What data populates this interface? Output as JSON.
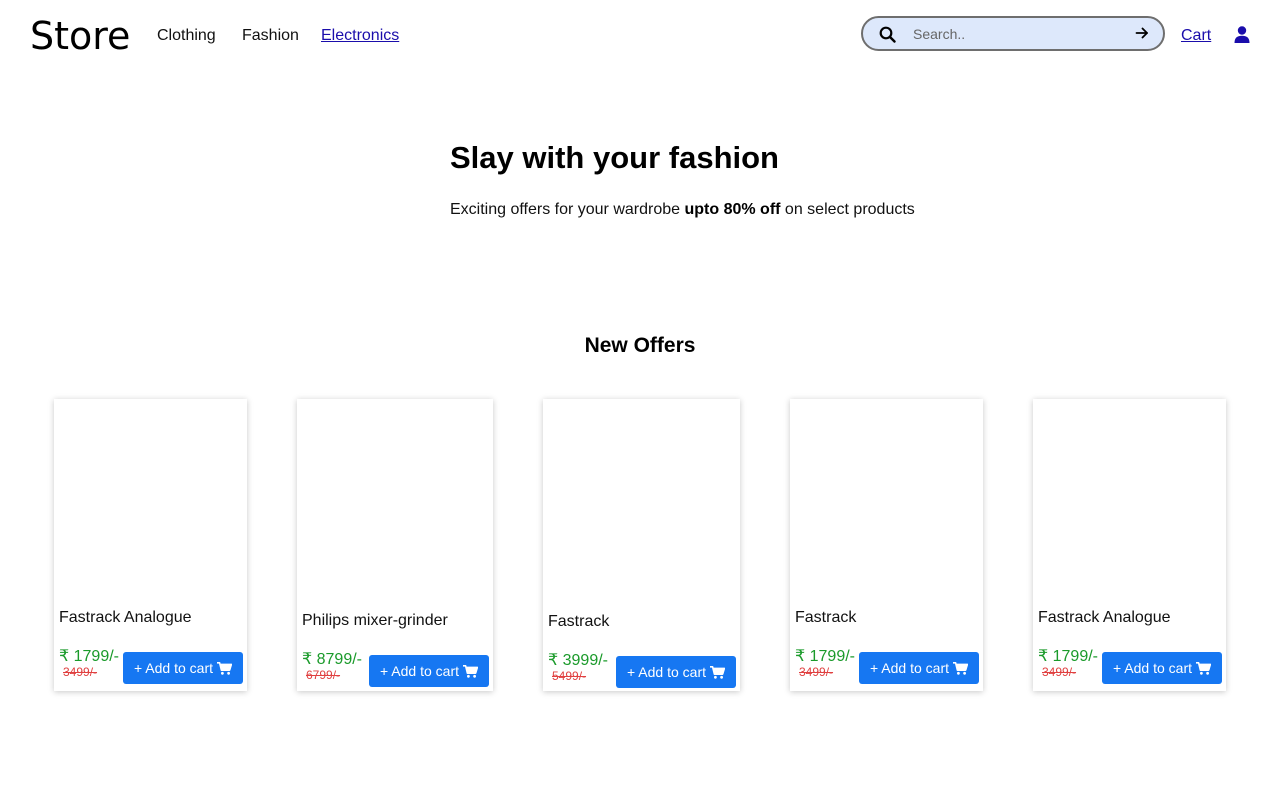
{
  "header": {
    "logo": "Store",
    "nav": [
      {
        "label": "Clothing",
        "active": false
      },
      {
        "label": "Fashion",
        "active": false
      },
      {
        "label": "Electronics",
        "active": true
      }
    ],
    "search": {
      "placeholder": "Search..",
      "value": "",
      "icon": "search-icon",
      "submit_icon": "arrow-right-icon"
    },
    "cart_label": "Cart",
    "user_icon": "user-icon"
  },
  "hero": {
    "title": "Slay with your fashion",
    "subtitle_pre": "Exciting offers for your wardrobe ",
    "subtitle_bold": "upto 80% off",
    "subtitle_post": " on select products"
  },
  "offers": {
    "title": "New Offers",
    "add_label": "+ Add to cart",
    "colors": {
      "price": "#1a9a2a",
      "old_price": "#e04040",
      "button": "#1677f2"
    },
    "products": [
      {
        "name": "Fastrack Analogue",
        "price": "₹ 1799/-",
        "old_price": "3499/-"
      },
      {
        "name": "Philips mixer-grinder",
        "price": "₹ 8799/-",
        "old_price": "6799/-"
      },
      {
        "name": "Fastrack",
        "price": "₹ 3999/-",
        "old_price": "5499/-"
      },
      {
        "name": "Fastrack",
        "price": "₹ 1799/-",
        "old_price": "3499/-"
      },
      {
        "name": "Fastrack Analogue",
        "price": "₹ 1799/-",
        "old_price": "3499/-"
      }
    ]
  }
}
